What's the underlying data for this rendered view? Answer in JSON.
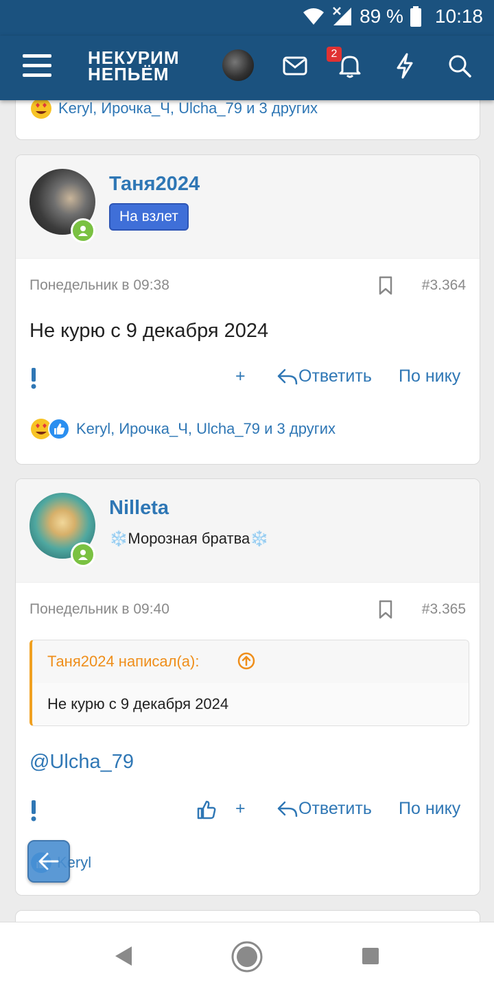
{
  "status": {
    "battery": "89 %",
    "time": "10:18"
  },
  "header": {
    "logo_line1": "НЕКУРИМ",
    "logo_line2": "НЕПЬЁМ",
    "notif_count": "2"
  },
  "prev_post": {
    "reactions_text": "Keryl, Ирочка_Ч, Ulcha_79 и 3 других"
  },
  "posts": [
    {
      "author": "Таня2024",
      "rank": "На взлет",
      "date": "Понедельник в 09:38",
      "number": "#3.364",
      "text": "Не курю с 9 декабря 2024",
      "actions": {
        "plus": "+",
        "reply": "Ответить",
        "by_nick": "По нику"
      },
      "reactions_text": "Keryl, Ирочка_Ч, Ulcha_79 и 3 других"
    },
    {
      "author": "Nilleta",
      "rank": "❄️Морозная братва❄️",
      "date": "Понедельник в 09:40",
      "number": "#3.365",
      "quote": {
        "author_line": "Таня2024 написал(а):",
        "text": "Не курю с 9 декабря 2024"
      },
      "text": "@Ulcha_79",
      "actions": {
        "plus": "+",
        "reply": "Ответить",
        "by_nick": "По нику"
      },
      "reactions_text": "Keryl"
    }
  ],
  "icons": {
    "menu": "menu-icon",
    "mail": "mail-icon",
    "bell": "bell-icon",
    "bolt": "bolt-icon",
    "search": "search-icon",
    "bookmark": "bookmark-icon",
    "report": "exclamation-icon",
    "reply": "reply-icon",
    "like": "thumbs-up-icon",
    "back": "arrow-left-icon"
  },
  "colors": {
    "header": "#1b527f",
    "link": "#2f77b5",
    "quote_accent": "#f0a020",
    "online": "#7ac142",
    "rank_badge": "#3f6fd8"
  }
}
